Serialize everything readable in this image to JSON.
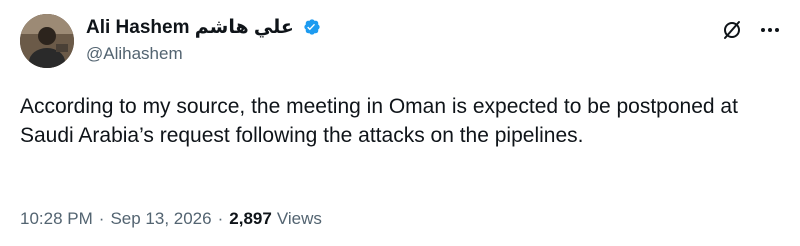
{
  "author": {
    "display_name": "Ali Hashem علي هاشم",
    "handle": "@Alihashem",
    "verified_icon": "verified-badge-icon",
    "verified_color": "#1d9bf0"
  },
  "actions": {
    "grok_icon": "grok-icon",
    "more_icon": "more-options-icon"
  },
  "tweet": {
    "text": "According to my source, the meeting in Oman is expected to be postponed at Saudi Arabia’s request following the attacks on the pipelines."
  },
  "meta": {
    "time": "10:28 PM",
    "separator": "·",
    "date": "Sep 13, 2026",
    "views_count": "2,897",
    "views_label": "Views"
  },
  "colors": {
    "primary_text": "#0f1419",
    "secondary_text": "#536471",
    "accent": "#1d9bf0"
  }
}
